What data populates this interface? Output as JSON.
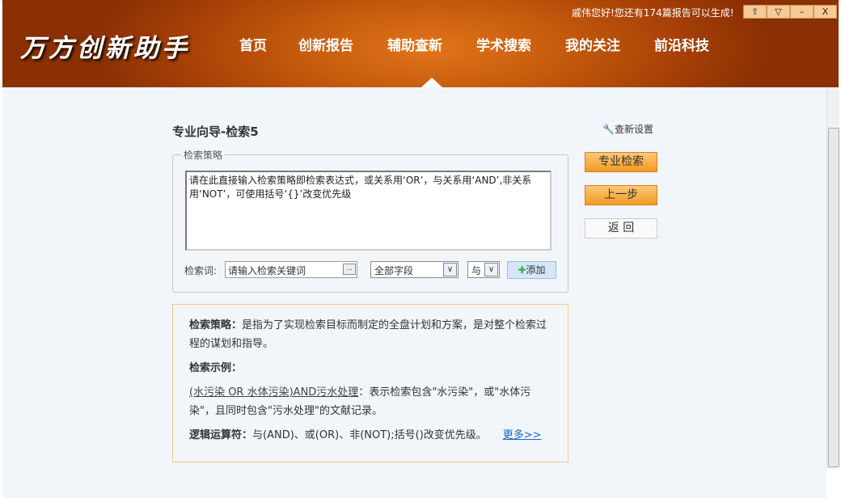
{
  "app": {
    "logo": "万方创新助手",
    "greeting": "戚伟您好!您还有174篇报告可以生成!",
    "window_buttons": [
      "⇧",
      "▽",
      "–",
      "X"
    ]
  },
  "nav": [
    "首页",
    "创新报告",
    "辅助查新",
    "学术搜索",
    "我的关注",
    "前沿科技"
  ],
  "page": {
    "title": "专业向导-检索5",
    "settings": "查新设置"
  },
  "strategy": {
    "legend": "检索策略",
    "placeholder": "请在此直接输入检索策略即检索表达式，或关系用‘OR’，与关系用‘AND’,非关系用‘NOT’，可使用括号‘{}’改变优先级",
    "keyword_label": "检索词:",
    "keyword_placeholder": "请输入检索关键词",
    "keyword_btn": "...",
    "field": "全部字段",
    "logic": "与",
    "add": "添加"
  },
  "buttons": {
    "pro_search": "专业检索",
    "prev": "上一步",
    "back": "返 回"
  },
  "info": {
    "t1": "检索策略：",
    "d1": "是指为了实现检索目标而制定的全盘计划和方案，是对整个检索过程的谋划和指导。",
    "t2": "检索示例：",
    "ex": "(水污染 OR 水体污染)AND污水处理",
    "exd": "：表示检索包含\"水污染\"，或\"水体污染\"，且同时包含\"污水处理\"的文献记录。",
    "t3": "逻辑运算符：",
    "d3": "与(AND)、或(OR)、非(NOT);括号()改变优先级。",
    "more": "更多>>"
  }
}
